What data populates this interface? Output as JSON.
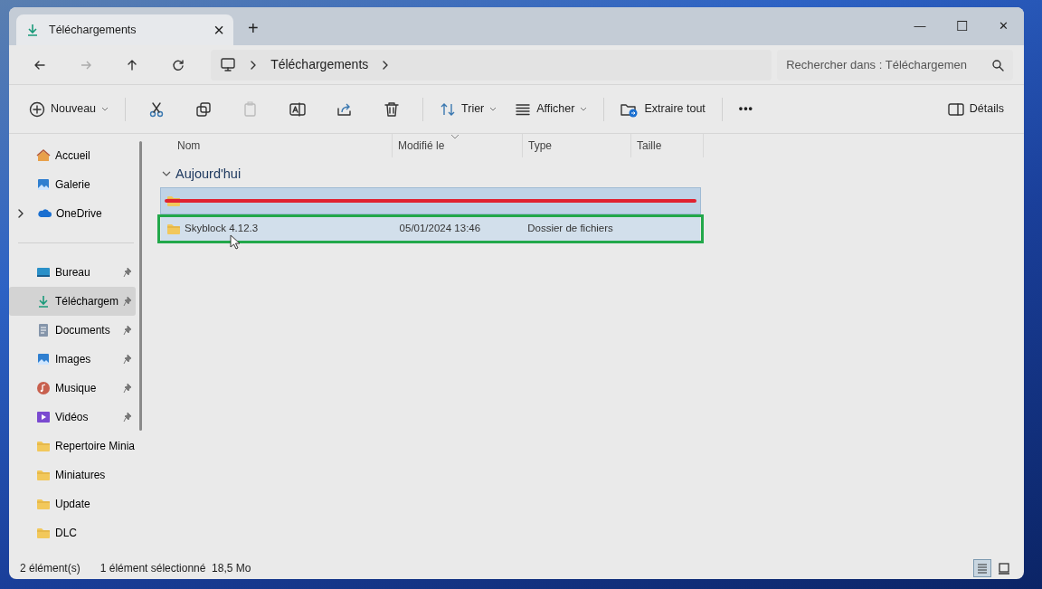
{
  "tab": {
    "title": "Téléchargements",
    "close": "×",
    "new_tab": "+"
  },
  "window_controls": [
    "—",
    "☐",
    "✕"
  ],
  "address": {
    "crumbs": [
      "Téléchargements"
    ],
    "search_placeholder": "Rechercher dans : Téléchargemen"
  },
  "toolbar": {
    "new": "Nouveau",
    "sort": "Trier",
    "view": "Afficher",
    "extract": "Extraire tout",
    "more": "•••",
    "details": "Détails"
  },
  "sidebar": {
    "items": [
      {
        "label": "Accueil",
        "selected": false,
        "expandable": false
      },
      {
        "label": "Galerie",
        "selected": false,
        "expandable": false
      },
      {
        "label": "OneDrive",
        "selected": false,
        "expandable": true
      }
    ],
    "quick": [
      {
        "label": "Bureau",
        "pinned": true,
        "selected": false
      },
      {
        "label": "Téléchargem",
        "pinned": true,
        "selected": true
      },
      {
        "label": "Documents",
        "pinned": true,
        "selected": false
      },
      {
        "label": "Images",
        "pinned": true,
        "selected": false
      },
      {
        "label": "Musique",
        "pinned": true,
        "selected": false
      },
      {
        "label": "Vidéos",
        "pinned": true,
        "selected": false
      },
      {
        "label": "Repertoire Minia",
        "pinned": false,
        "selected": false
      },
      {
        "label": "Miniatures",
        "pinned": false,
        "selected": false
      },
      {
        "label": "Update",
        "pinned": false,
        "selected": false
      },
      {
        "label": "DLC",
        "pinned": false,
        "selected": false
      }
    ]
  },
  "table": {
    "columns": [
      "Nom",
      "Modifié le",
      "Type",
      "Taille"
    ],
    "group": "Aujourd'hui",
    "rows": [
      {
        "selected": true,
        "hovered": false,
        "struck_out": true,
        "outlined": false
      },
      {
        "name": "Skyblock 4.12.3",
        "modified": "05/01/2024 13:46",
        "type": "Dossier de fichiers",
        "selected": false,
        "hovered": true,
        "struck_out": false,
        "outlined": true
      }
    ]
  },
  "status_bar": {
    "count": "2 élément(s)",
    "selection": "1 élément sélectionné  18,5 Mo"
  },
  "view_modes": [
    {
      "kind": "details",
      "selected": true
    },
    {
      "kind": "tiles",
      "selected": false
    }
  ]
}
